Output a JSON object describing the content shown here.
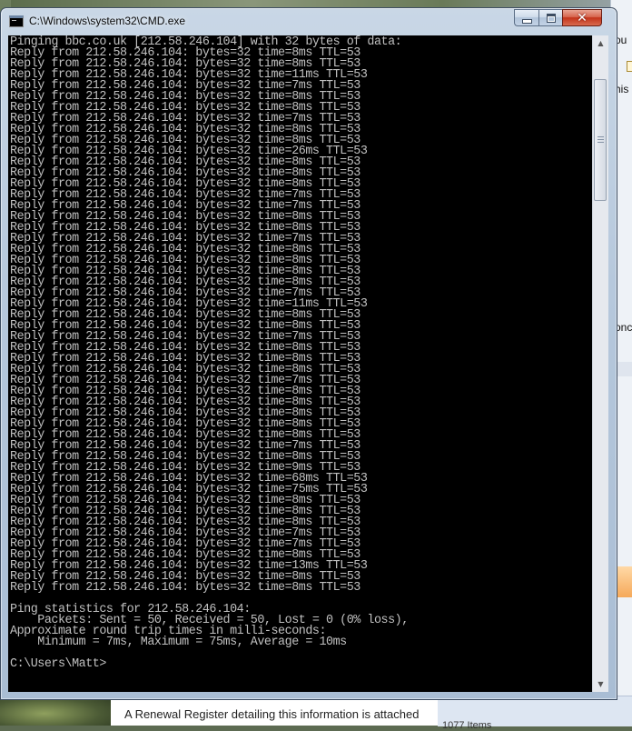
{
  "window": {
    "title": "C:\\Windows\\system32\\CMD.exe",
    "close_symbol": "✕"
  },
  "console": {
    "lines": [
      "Pinging bbc.co.uk [212.58.246.104] with 32 bytes of data:",
      "Reply from 212.58.246.104: bytes=32 time=8ms TTL=53",
      "Reply from 212.58.246.104: bytes=32 time=8ms TTL=53",
      "Reply from 212.58.246.104: bytes=32 time=11ms TTL=53",
      "Reply from 212.58.246.104: bytes=32 time=7ms TTL=53",
      "Reply from 212.58.246.104: bytes=32 time=8ms TTL=53",
      "Reply from 212.58.246.104: bytes=32 time=8ms TTL=53",
      "Reply from 212.58.246.104: bytes=32 time=7ms TTL=53",
      "Reply from 212.58.246.104: bytes=32 time=8ms TTL=53",
      "Reply from 212.58.246.104: bytes=32 time=8ms TTL=53",
      "Reply from 212.58.246.104: bytes=32 time=26ms TTL=53",
      "Reply from 212.58.246.104: bytes=32 time=8ms TTL=53",
      "Reply from 212.58.246.104: bytes=32 time=8ms TTL=53",
      "Reply from 212.58.246.104: bytes=32 time=8ms TTL=53",
      "Reply from 212.58.246.104: bytes=32 time=7ms TTL=53",
      "Reply from 212.58.246.104: bytes=32 time=7ms TTL=53",
      "Reply from 212.58.246.104: bytes=32 time=8ms TTL=53",
      "Reply from 212.58.246.104: bytes=32 time=8ms TTL=53",
      "Reply from 212.58.246.104: bytes=32 time=7ms TTL=53",
      "Reply from 212.58.246.104: bytes=32 time=8ms TTL=53",
      "Reply from 212.58.246.104: bytes=32 time=8ms TTL=53",
      "Reply from 212.58.246.104: bytes=32 time=8ms TTL=53",
      "Reply from 212.58.246.104: bytes=32 time=8ms TTL=53",
      "Reply from 212.58.246.104: bytes=32 time=7ms TTL=53",
      "Reply from 212.58.246.104: bytes=32 time=11ms TTL=53",
      "Reply from 212.58.246.104: bytes=32 time=8ms TTL=53",
      "Reply from 212.58.246.104: bytes=32 time=8ms TTL=53",
      "Reply from 212.58.246.104: bytes=32 time=7ms TTL=53",
      "Reply from 212.58.246.104: bytes=32 time=8ms TTL=53",
      "Reply from 212.58.246.104: bytes=32 time=8ms TTL=53",
      "Reply from 212.58.246.104: bytes=32 time=8ms TTL=53",
      "Reply from 212.58.246.104: bytes=32 time=7ms TTL=53",
      "Reply from 212.58.246.104: bytes=32 time=8ms TTL=53",
      "Reply from 212.58.246.104: bytes=32 time=8ms TTL=53",
      "Reply from 212.58.246.104: bytes=32 time=8ms TTL=53",
      "Reply from 212.58.246.104: bytes=32 time=8ms TTL=53",
      "Reply from 212.58.246.104: bytes=32 time=8ms TTL=53",
      "Reply from 212.58.246.104: bytes=32 time=7ms TTL=53",
      "Reply from 212.58.246.104: bytes=32 time=8ms TTL=53",
      "Reply from 212.58.246.104: bytes=32 time=9ms TTL=53",
      "Reply from 212.58.246.104: bytes=32 time=68ms TTL=53",
      "Reply from 212.58.246.104: bytes=32 time=75ms TTL=53",
      "Reply from 212.58.246.104: bytes=32 time=8ms TTL=53",
      "Reply from 212.58.246.104: bytes=32 time=8ms TTL=53",
      "Reply from 212.58.246.104: bytes=32 time=8ms TTL=53",
      "Reply from 212.58.246.104: bytes=32 time=7ms TTL=53",
      "Reply from 212.58.246.104: bytes=32 time=7ms TTL=53",
      "Reply from 212.58.246.104: bytes=32 time=8ms TTL=53",
      "Reply from 212.58.246.104: bytes=32 time=13ms TTL=53",
      "Reply from 212.58.246.104: bytes=32 time=8ms TTL=53",
      "Reply from 212.58.246.104: bytes=32 time=8ms TTL=53",
      "",
      "Ping statistics for 212.58.246.104:",
      "    Packets: Sent = 50, Received = 50, Lost = 0 (0% loss),",
      "Approximate round trip times in milli-seconds:",
      "    Minimum = 7ms, Maximum = 75ms, Average = 10ms",
      "",
      "C:\\Users\\Matt>"
    ]
  },
  "background": {
    "document_text": "A Renewal Register detailing this information is attached",
    "status_text": "1077 Items",
    "right_fragments": [
      "ou",
      "his",
      "onc"
    ]
  },
  "icons": {
    "title": "cmd-icon",
    "minimize": "minimize-icon",
    "maximize": "maximize-icon",
    "close": "close-icon",
    "scroll_up": "scroll-up-arrow-icon",
    "scroll_down": "scroll-down-arrow-icon"
  }
}
